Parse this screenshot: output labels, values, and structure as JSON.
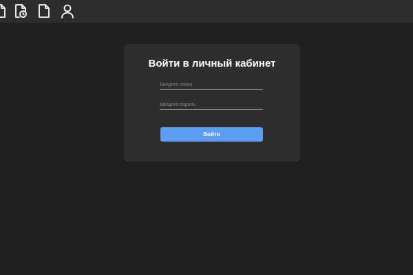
{
  "nav": {
    "icons": [
      "document-edit-icon",
      "document-clock-icon",
      "document-icon",
      "user-icon"
    ]
  },
  "login": {
    "title": "Войти в личный кабинет",
    "login_placeholder": "Введите логин",
    "password_placeholder": "Введите пароль",
    "submit_label": "Войти"
  },
  "colors": {
    "background": "#202020",
    "topbar": "#2d2d2d",
    "card": "#2e2e2e",
    "accent": "#5b9cf5"
  }
}
